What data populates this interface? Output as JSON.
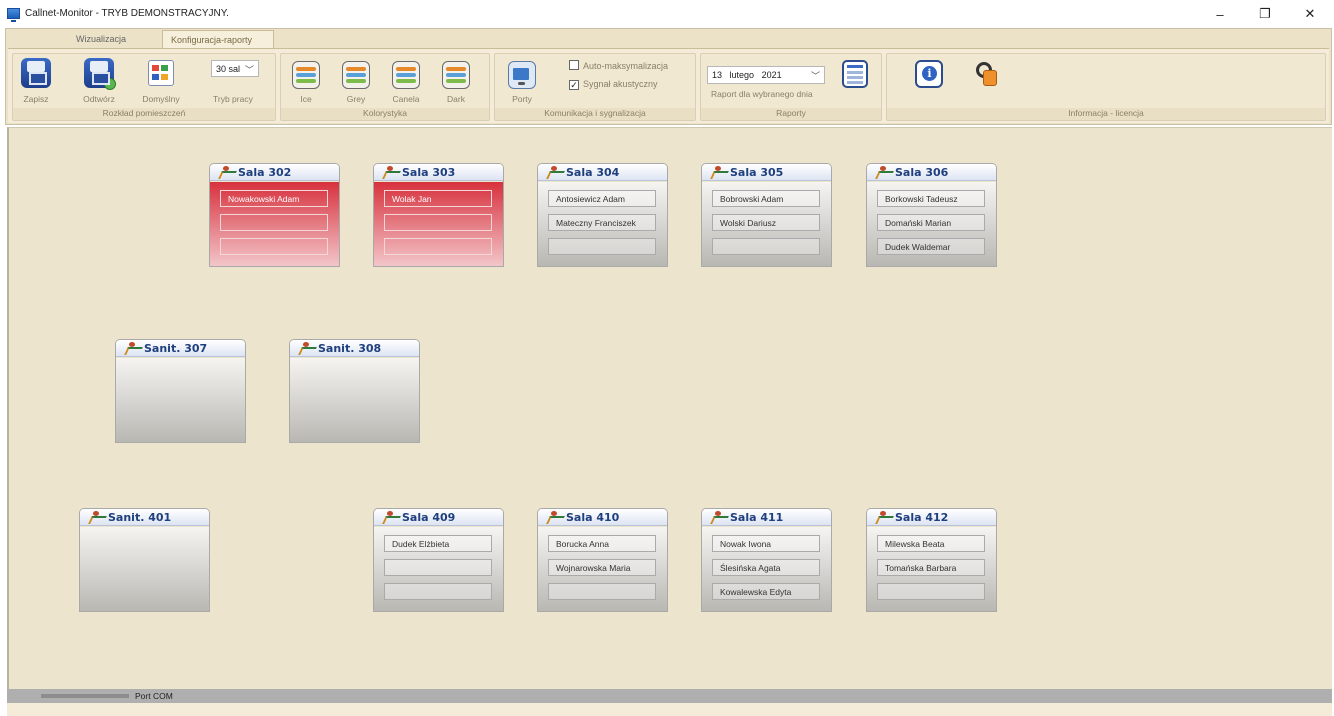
{
  "window": {
    "title": "Callnet-Monitor - TRYB DEMONSTRACYJNY.",
    "minimize": "–",
    "restore": "❐",
    "close": "✕"
  },
  "tabs": [
    {
      "label": "Wizualizacja",
      "active": false
    },
    {
      "label": "Konfiguracja-raporty",
      "active": true
    }
  ],
  "ribbon": {
    "layout_group": {
      "title": "Rozkład pomieszczeń",
      "save": "Zapisz",
      "restore": "Odtwórz",
      "default": "Domyślny",
      "mode_label": "Tryb pracy",
      "mode_value": "30 sal"
    },
    "colors_group": {
      "title": "Kolorystyka",
      "items": [
        "Ice",
        "Grey",
        "Canela",
        "Dark"
      ]
    },
    "comm_group": {
      "title": "Komunikacja i sygnalizacja",
      "ports": "Porty",
      "auto_max": "Auto-maksymalizacja",
      "auto_max_checked": false,
      "sound": "Sygnał akustyczny",
      "sound_checked": true
    },
    "reports_group": {
      "title": "Raporty",
      "date_day": "13",
      "date_month": "lutego",
      "date_year": "2021",
      "report_label": "Raport dla wybranego dnia"
    },
    "info_group": {
      "title": "Informacja - licencja"
    }
  },
  "rooms": [
    {
      "name": "Sala 302",
      "alert": true,
      "patients": [
        "Nowakowski Adam",
        "",
        ""
      ]
    },
    {
      "name": "Sala 303",
      "alert": true,
      "patients": [
        "Wolak Jan",
        "",
        ""
      ]
    },
    {
      "name": "Sala 304",
      "alert": false,
      "patients": [
        "Antosiewicz Adam",
        "Mateczny Franciszek",
        ""
      ]
    },
    {
      "name": "Sala 305",
      "alert": false,
      "patients": [
        "Bobrowski Adam",
        "Wolski Dariusz",
        ""
      ]
    },
    {
      "name": "Sala 306",
      "alert": false,
      "patients": [
        "Borkowski Tadeusz",
        "Domański Marian",
        "Dudek Waldemar"
      ]
    },
    {
      "name": "Sanit. 307",
      "alert": false,
      "patients": []
    },
    {
      "name": "Sanit. 308",
      "alert": false,
      "patients": []
    },
    {
      "name": "Sanit. 401",
      "alert": false,
      "patients": []
    },
    {
      "name": "Sala 409",
      "alert": false,
      "patients": [
        "Dudek Elżbieta",
        "",
        ""
      ]
    },
    {
      "name": "Sala 410",
      "alert": false,
      "patients": [
        "Borucka Anna",
        "Wojnarowska Maria",
        ""
      ]
    },
    {
      "name": "Sala 411",
      "alert": false,
      "patients": [
        "Nowak Iwona",
        "Ślesińska Agata",
        "Kowalewska Edyta"
      ]
    },
    {
      "name": "Sala 412",
      "alert": false,
      "patients": [
        "Milewska Beata",
        "Tomańska Barbara",
        ""
      ]
    }
  ],
  "status": {
    "port_label": "Port COM"
  }
}
